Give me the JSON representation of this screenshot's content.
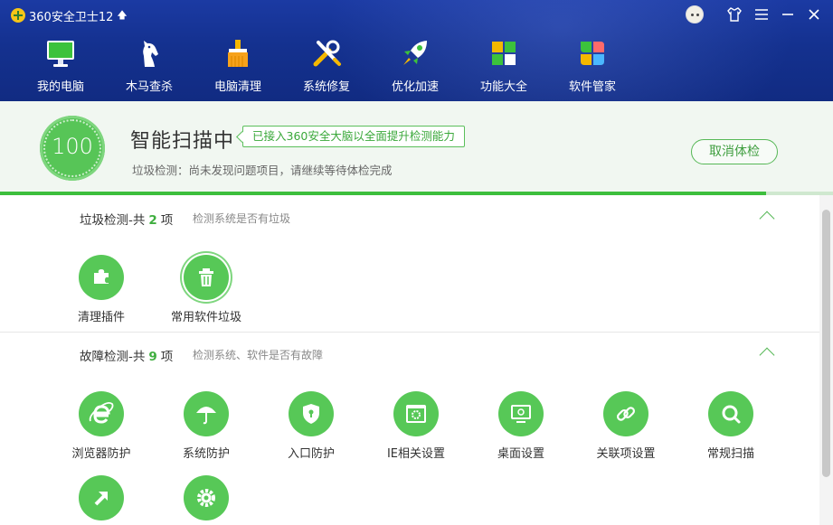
{
  "app": {
    "title": "360安全卫士12"
  },
  "nav": [
    {
      "label": "我的电脑",
      "icon": "computer-icon"
    },
    {
      "label": "木马查杀",
      "icon": "horse-icon"
    },
    {
      "label": "电脑清理",
      "icon": "broom-icon"
    },
    {
      "label": "系统修复",
      "icon": "tools-icon"
    },
    {
      "label": "优化加速",
      "icon": "rocket-icon"
    },
    {
      "label": "功能大全",
      "icon": "apps-grid-icon"
    },
    {
      "label": "软件管家",
      "icon": "software-flower-icon"
    }
  ],
  "scan": {
    "score": "100",
    "title": "智能扫描中",
    "brain_tag": "已接入360安全大脑以全面提升检测能力",
    "subtitle": "垃圾检测：尚未发现问题项目，请继续等待体检完成",
    "cancel_label": "取消体检",
    "progress": 0.92
  },
  "sections": [
    {
      "title_prefix": "垃圾检测-共",
      "count": "2",
      "title_suffix": "项",
      "desc": "检测系统是否有垃圾",
      "items": [
        {
          "label": "清理插件",
          "icon": "puzzle-icon"
        },
        {
          "label": "常用软件垃圾",
          "icon": "trash-icon"
        }
      ]
    },
    {
      "title_prefix": "故障检测-共",
      "count": "9",
      "title_suffix": "项",
      "desc": "检测系统、软件是否有故障",
      "items": [
        {
          "label": "浏览器防护",
          "icon": "ie-browser-icon"
        },
        {
          "label": "系统防护",
          "icon": "umbrella-icon"
        },
        {
          "label": "入口防护",
          "icon": "shield-lock-icon"
        },
        {
          "label": "IE相关设置",
          "icon": "ie-settings-icon"
        },
        {
          "label": "桌面设置",
          "icon": "desktop-icon"
        },
        {
          "label": "关联项设置",
          "icon": "link-icon"
        },
        {
          "label": "常规扫描",
          "icon": "search-icon"
        },
        {
          "label": "",
          "icon": "shortcut-arrow-icon"
        },
        {
          "label": "",
          "icon": "gear-icon"
        }
      ]
    }
  ],
  "colors": {
    "header": "#14318f",
    "accent": "#57c857",
    "banner": "#f1f7f1"
  }
}
